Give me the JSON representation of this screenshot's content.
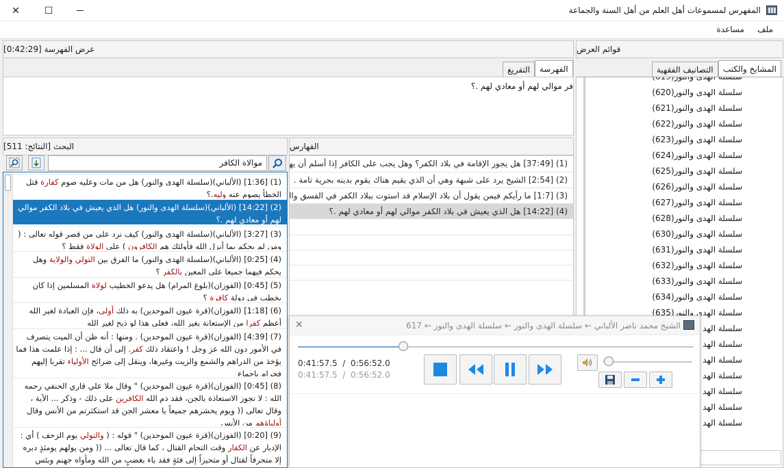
{
  "window": {
    "title": "المفهرس لمسموعات أهل العلم من أهل السنة والجماعة",
    "minimize": "—",
    "maximize": "☐",
    "close": "✕"
  },
  "menu": {
    "file": "ملف",
    "help": "مساعدة"
  },
  "display": {
    "header": "عرض الفهرسة [0:42:29]",
    "tab_index": "الفهرسة",
    "tab_transcript": "التفريغ",
    "text": "فر موالي لهم أو معادي لهم .؟"
  },
  "lists": {
    "header": "قوائم العرض",
    "tab_scholars": "المشايخ والكتب",
    "tab_categories": "التصانيف الفقهية",
    "items": [
      "سلسلة الهدى والنور(619)",
      "سلسلة الهدى والنور(620)",
      "سلسلة الهدى والنور(621)",
      "سلسلة الهدى والنور(622)",
      "سلسلة الهدى والنور(623)",
      "سلسلة الهدى والنور(624)",
      "سلسلة الهدى والنور(625)",
      "سلسلة الهدى والنور(626)",
      "سلسلة الهدى والنور(627)",
      "سلسلة الهدى والنور(628)",
      "سلسلة الهدى والنور(630)",
      "سلسلة الهدى والنور(631)",
      "سلسلة الهدى والنور(632)",
      "سلسلة الهدى والنور(633)",
      "سلسلة الهدى والنور(634)",
      "سلسلة الهدى والنور(635)",
      "سلسلة الهد",
      "سلسلة الهد",
      "سلسلة الهد",
      "سلسلة الهد",
      "سلسلة الهد",
      "سلسلة الهد",
      "سلسلة الهد"
    ]
  },
  "indexes": {
    "header": "الفهارس",
    "rows": [
      "(1) [37:49] هل يجوز الإقامة في بلاد الكفر؟ وهل يجب على الكافر إذا أسلم أن يهاجر إلى",
      "(2) [2:54] الشيخ يرد على شبهة وهي أن الذي يقيم هناك يقوم بدينه بحرية تامة .",
      "(3) [1:7] ما رأيكم فيمن يقول أن بلاد الإسلام قد استوت ببلاد الكفر في الفسق والفجور",
      "(4) [14:22] هل الذي يعيش في بلاد الكفر موالي لهم أو معادي لهم .؟"
    ]
  },
  "search": {
    "header": "البحث [النتائج: 511]",
    "query": "موالاة الكافر",
    "results": [
      {
        "pre": "(1) [1:36] (الألباني)(سلسلة الهدى والنور) هل من مات وعليه صوم ",
        "kw": "كفارة",
        "post": " قتل الخطأ يصوم عنه ",
        "kw2": "وليه",
        "end": ".؟"
      },
      {
        "pre": "(2) [14:22] (الألباني)(سلسلة الهدى والنور) هل الذي يعيش في بلاد الكفر موالي لهم أو معادي لهم .؟",
        "kw": "",
        "post": "",
        "kw2": "",
        "end": ""
      },
      {
        "pre": "(3) [3:27] (الألباني)(سلسلة الهدى والنور) كيف نرد على من قصر قوله تعالى : ( ومن لم يحكم بما أنزل الله فأولئك هم ",
        "kw": "الكافرون",
        "post": " ) على ",
        "kw2": "الولاة",
        "end": " فقط ؟"
      },
      {
        "pre": "(4) [0:25] (الألباني)(سلسلة الهدى والنور) ما الفرق بين ",
        "kw": "التولي والولاية",
        "post": " وهل يحكم فيهما جميعا على المعين ",
        "kw2": "بالكفر",
        "end": " ؟"
      },
      {
        "pre": "(5) [0:45] (الفوزان)(بلوغ المرام) هل يدعو الخطيب ",
        "kw": "لولاة",
        "post": " المسلمين إذا كان يخطب في دولة ",
        "kw2": "كافرة",
        "end": " ؟"
      },
      {
        "pre": "(6) [1:18] (الفوزان)(قرة عيون الموحدين) به ذلك ",
        "kw": "أولى",
        "post": "، فإن العبادة لغير الله أعظم ",
        "kw2": "كفرا",
        "end": " من الإستعانة بغير الله، فعلى هذا لو ذبح لغير الله"
      },
      {
        "pre": "(7) [4:39] (الفوزان)(قرة عيون الموحدين) . ومنها : أنه ظن أن الميت يتصرف في الأمور دون الله عز وجل ! واعتقاد ذلك ",
        "kw": "كفر",
        "post": ". إلى أن قال ... : إذا علمت هذا فما يؤخذ من الدراهم والشمع والزيت وغيرها، وينقل إلى ضرائح ",
        "kw2": "الأولياء",
        "end": " تقربا إليهم فحرام بإجماع"
      },
      {
        "pre": "(8) [0:45] (الفوزان)(قرة عيون الموحدين) \" وقال ملا علي قاري الحنفي رحمه الله : لا تجوز الاستعاذة بالجن، فقد ذم الله ",
        "kw": "الكافرين",
        "post": " على ذلك - وذكر ... الآية ، وقال تعالى (( ويوم يحشرهم جميعاً يا معشر الجن قد استكثرتم من الأنس وقال ",
        "kw2": "أولياؤهم",
        "end": " من الأنس"
      },
      {
        "pre": "(9) [0:20] (الفوزان)(قرة عيون الموحدين) \" قوله : ( ",
        "kw": "والتولي",
        "post": " يوم الزحف ) أي : الإدبار عن ",
        "kw2": "الكفار",
        "end": " وقت التحام القتال ، كما قال تعالى ... (( ومن يولهم يومئذٍ دبره إلا متحرفاً لقتال أو متحيزاً إلى فئةٍ فقد باء بغضبٍ من الله ومأواه جهنم وبئس المصير )) \""
      }
    ]
  },
  "player": {
    "title": "الشيخ محمد ناصر الألباني ← سلسلة الهدى والنور ← سلسلة الهدى والنور ← 617",
    "close": "✕",
    "time_current": "0:41:57.5",
    "time_total": "0:56:52.0",
    "sep": "/",
    "progress": 0.266,
    "volume": 0.0
  }
}
